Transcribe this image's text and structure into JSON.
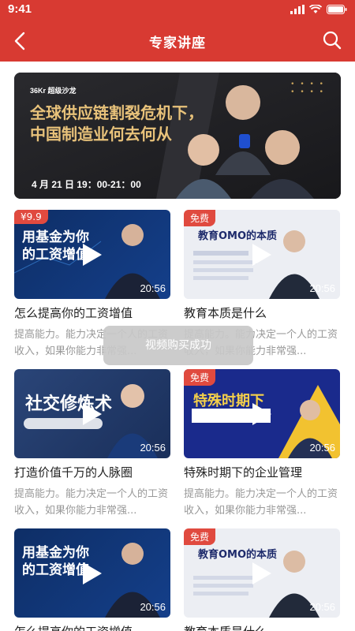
{
  "status_bar": {
    "time": "9:41"
  },
  "nav": {
    "title": "专家讲座"
  },
  "banner": {
    "brand": "36Kr 超级沙龙",
    "headline_line1": "全球供应链割裂危机下，",
    "headline_line2": "中国制造业何去何从",
    "time": "4 月 21 日 19：00-21：00"
  },
  "toast": {
    "text": "视频购买成功"
  },
  "cards": [
    {
      "tag": "¥9.9",
      "thumb_text": "用基金为你的工资增值",
      "duration": "20:56",
      "title": "怎么提高你的工资增值",
      "desc": "提高能力。能力决定一个人的工资收入，如果你能力非常强..."
    },
    {
      "tag": "免费",
      "thumb_text": "教育OMO的本质",
      "duration": "20:56",
      "title": "教育本质是什么",
      "desc": "提高能力。能力决定一个人的工资收入，如果你能力非常强..."
    },
    {
      "tag": "",
      "thumb_text": "社交修炼术",
      "duration": "20:56",
      "title": "打造价值千万的人脉圈",
      "desc": "提高能力。能力决定一个人的工资收入，如果你能力非常强..."
    },
    {
      "tag": "免费",
      "thumb_text": "特殊时期下",
      "duration": "20:56",
      "title": "特殊时期下的企业管理",
      "desc": "提高能力。能力决定一个人的工资收入，如果你能力非常强..."
    },
    {
      "tag": "",
      "thumb_text": "用基金为你的工资增值",
      "duration": "20:56",
      "title": "怎么提高你的工资增值",
      "desc": ""
    },
    {
      "tag": "免费",
      "thumb_text": "教育OMO的本质",
      "duration": "20:56",
      "title": "教育本质是什么",
      "desc": ""
    }
  ]
}
